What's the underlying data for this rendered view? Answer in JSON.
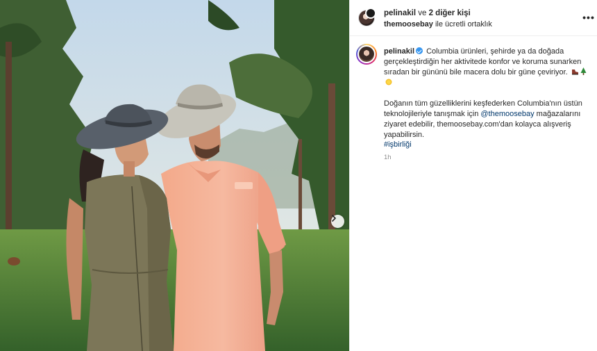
{
  "header": {
    "username": "pelinakil",
    "connector": " ve ",
    "others": "2 diğer kişi",
    "partner": "themoosebay",
    "partner_suffix": " ile ücretli ortaklık",
    "more_label": "•••"
  },
  "caption": {
    "username": "pelinakil",
    "paragraph1": "Columbia ürünleri, şehirde ya da doğada gerçekleştirdiğin her aktivitede konfor ve koruma sunarken sıradan bir gününü bile macera dolu bir güne çeviriyor.",
    "emojis": [
      "hiking-boot-emoji",
      "evergreen-tree-emoji",
      "sun-emoji"
    ],
    "paragraph2_part1": "Doğanın tüm güzelliklerini keşfederken Columbia'nın üstün teknolojileriyle tanışmak için ",
    "mention": "@themoosebay",
    "paragraph2_part2": " mağazalarını ziyaret edebilir, themoosebay.com'dan kolayca alışveriş yapabilirsin.",
    "hashtag": "#işbirliği",
    "time": "1h"
  },
  "photo": {
    "next_icon": "chevron-right-icon"
  },
  "colors": {
    "link": "#00376b",
    "verified": "#3897f0",
    "muted": "#8e8e8e",
    "text": "#262626"
  }
}
